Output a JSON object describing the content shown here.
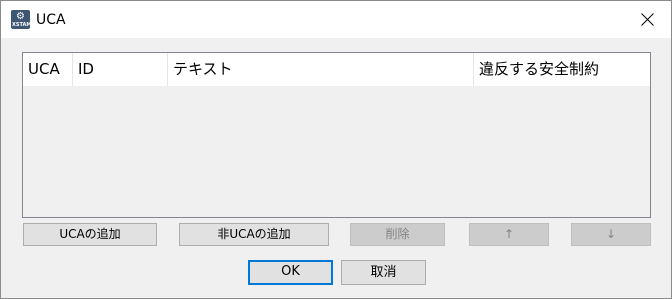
{
  "window": {
    "title": "UCA",
    "app_icon": {
      "name": "app-icon",
      "caption": "XSTAMP",
      "color": "#3e5673"
    }
  },
  "table": {
    "columns": [
      "UCA",
      "ID",
      "テキスト",
      "違反する安全制約"
    ],
    "rows": []
  },
  "buttons": {
    "add_uca": "UCAの追加",
    "add_non_uca": "非UCAの追加",
    "delete": "削除",
    "up": "↑",
    "down": "↓",
    "ok": "OK",
    "cancel": "取消"
  },
  "colors": {
    "focus_border": "#0078d7",
    "dialog_bg": "#f0f0f0"
  }
}
